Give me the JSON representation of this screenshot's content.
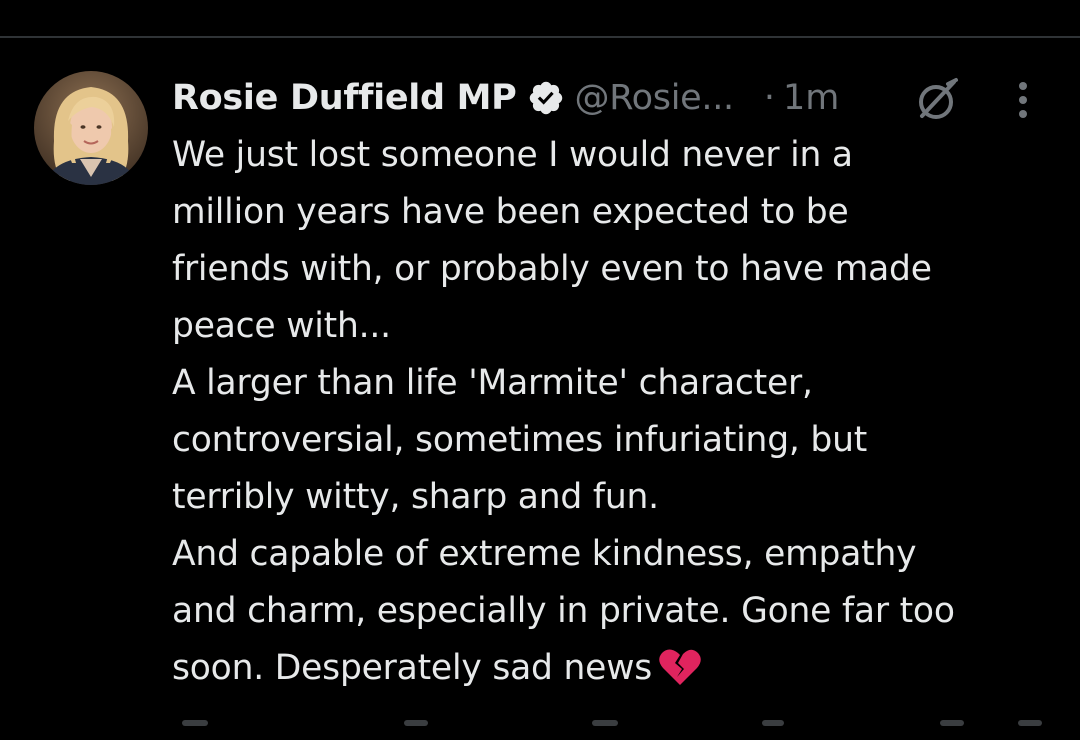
{
  "tweet": {
    "display_name": "Rosie Duffield MP",
    "handle": "@Rosie...",
    "separator": "·",
    "time": "1m",
    "text": "We just lost someone I would never in a\nmillion years have been expected to be\nfriends with, or probably even to have made\npeace with...\nA larger than life 'Marmite' character,\ncontroversial, sometimes infuriating, but\nterribly witty, sharp and fun.\nAnd capable of extreme kindness, empathy\nand charm, especially in private. Gone far too\nsoon. Desperately sad news",
    "emoji": "broken-heart-icon"
  },
  "icons": {
    "verified": "verified-badge-icon",
    "grok": "grok-icon",
    "more": "more-vertical-icon"
  },
  "colors": {
    "background": "#000000",
    "primary_text": "#e7e9ea",
    "secondary_text": "#71767b",
    "divider": "#2f3336",
    "broken_heart": "#e0245e"
  }
}
